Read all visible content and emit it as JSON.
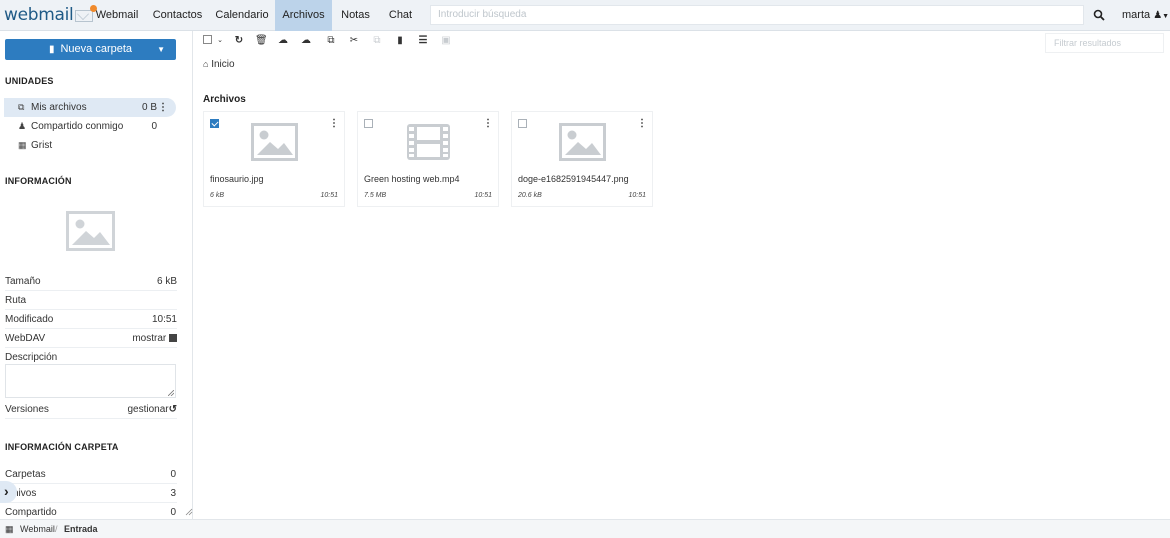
{
  "app": {
    "logo": "webmail"
  },
  "nav": [
    {
      "label": "Webmail",
      "active": false
    },
    {
      "label": "Contactos",
      "active": false
    },
    {
      "label": "Calendario",
      "active": false
    },
    {
      "label": "Archivos",
      "active": true
    },
    {
      "label": "Notas",
      "active": false
    },
    {
      "label": "Chat",
      "active": false
    }
  ],
  "search": {
    "placeholder": "Introducir búsqueda"
  },
  "user": {
    "name": "marta"
  },
  "sidebar": {
    "new_folder": "Nueva carpeta",
    "units_heading": "UNIDADES",
    "drives": [
      {
        "label": "Mis archivos",
        "value": "0 B",
        "icon": "files-icon",
        "active": true
      },
      {
        "label": "Compartido conmigo",
        "value": "0",
        "icon": "users-icon",
        "active": false
      },
      {
        "label": "Grist",
        "value": "",
        "icon": "table-icon",
        "active": false
      }
    ],
    "info_heading": "INFORMACIÓN",
    "info": {
      "size_label": "Tamaño",
      "size_value": "6 kB",
      "path_label": "Ruta",
      "modified_label": "Modificado",
      "modified_value": "10:51",
      "webdav_label": "WebDAV",
      "webdav_value": "mostrar",
      "description_label": "Descripción",
      "versions_label": "Versiones",
      "versions_value": "gestionar"
    },
    "folder_info_heading": "INFORMACIÓN CARPETA",
    "folder_info": {
      "folders_label": "Carpetas",
      "folders_value": "0",
      "files_label": "hivos",
      "files_value": "3",
      "shared_label": "Compartido",
      "shared_value": "0"
    }
  },
  "main": {
    "filter_placeholder": "Filtrar resultados",
    "breadcrumb": "Inicio",
    "folder_title": "Archivos",
    "files": [
      {
        "name": "finosaurio.jpg",
        "size": "6 kB",
        "time": "10:51",
        "type": "image",
        "selected": true
      },
      {
        "name": "Green hosting web.mp4",
        "size": "7.5 MB",
        "time": "10:51",
        "type": "video",
        "selected": false
      },
      {
        "name": "doge-e1682591945447.png",
        "size": "20.6 kB",
        "time": "10:51",
        "type": "image",
        "selected": false
      }
    ]
  },
  "bottom": {
    "crumb1": "Webmail",
    "separator": "/",
    "crumb2": "Entrada"
  },
  "colors": {
    "accent": "#2d7cc0",
    "nav_active": "#bcd3ea",
    "topbar": "#eef2f6"
  }
}
